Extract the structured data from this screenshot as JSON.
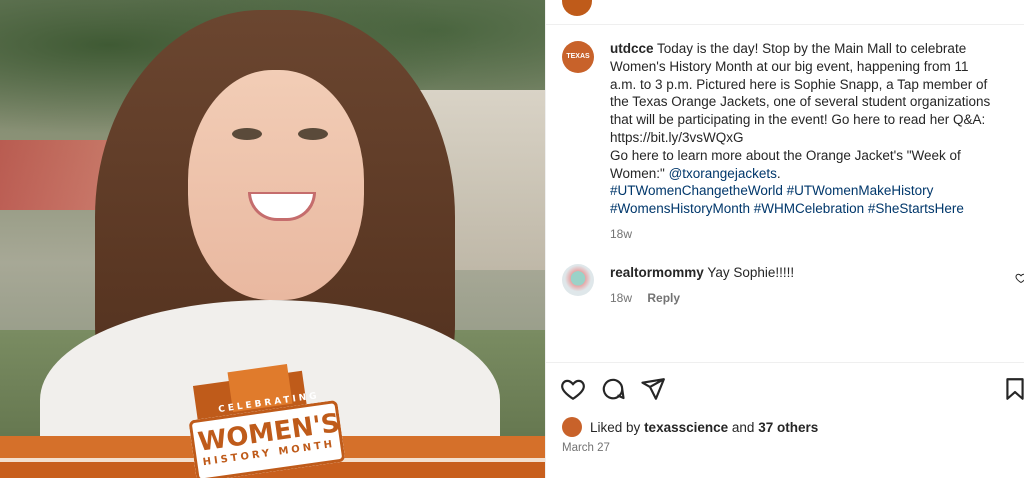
{
  "post": {
    "account": "utdcce",
    "avatar_label": "TEXAS",
    "caption_lines": [
      "Today is the day! Stop by the Main Mall to celebrate",
      "Women's History Month at our big event, happening from 11",
      "a.m. to 3 p.m. Pictured here is Sophie Snapp, a Tap member of",
      "the Texas Orange Jackets, one of several student organizations",
      "that will be participating in the event! Go here to read her Q&A:",
      "https://bit.ly/3vsWQxG",
      "Go here to learn more about the Orange Jacket's \"Week of",
      "Women:\""
    ],
    "mention": "@txorangejackets",
    "mention_suffix": ".",
    "hashtags_line1": "#UTWomenChangetheWorld #UTWomenMakeHistory",
    "hashtags_line2": "#WomensHistoryMonth #WHMCelebration #SheStartsHere",
    "time": "18w"
  },
  "image": {
    "badge_top": "CELEBRATING",
    "badge_main": "WOMEN'S",
    "badge_bottom": "HISTORY MONTH"
  },
  "comment": {
    "user": "realtormommy",
    "text": "Yay Sophie!!!!!",
    "time": "18w",
    "reply_label": "Reply"
  },
  "actions": {
    "like_icon": "heart-icon",
    "comment_icon": "comment-bubble-icon",
    "share_icon": "paper-plane-icon",
    "save_icon": "bookmark-icon"
  },
  "likes": {
    "prefix": "Liked by",
    "user": "texasscience",
    "middle": "and",
    "others": "37 others"
  },
  "date": "March 27",
  "colors": {
    "brand_orange": "#bf5b1a",
    "link": "#00376b",
    "muted": "#737373"
  }
}
